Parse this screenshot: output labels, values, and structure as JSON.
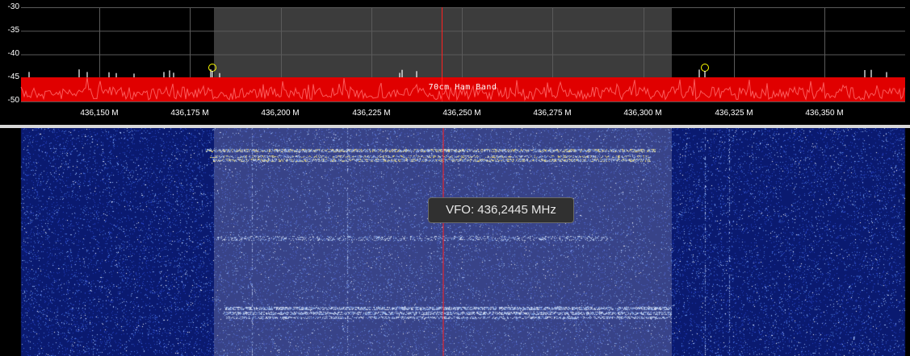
{
  "spectrum": {
    "y_axis_labels": [
      "-30",
      "-35",
      "-40",
      "-45",
      "-50"
    ],
    "y_axis_values": [
      -30,
      -35,
      -40,
      -45,
      -50
    ],
    "x_axis_labels": [
      "436,150 M",
      "436,175 M",
      "436,200 M",
      "436,225 M",
      "436,250 M",
      "436,275 M",
      "436,300 M",
      "436,325 M",
      "436,350 M"
    ],
    "x_axis_mhz": [
      436.15,
      436.175,
      436.2,
      436.225,
      436.25,
      436.275,
      436.3,
      436.325,
      436.35
    ],
    "band_label": "70cm Ham Band",
    "band_color": "#e00000",
    "passband_color": "#3c3c3c",
    "vfo_line_color": "#ff2020",
    "peak_marker_color": "#ffff00"
  },
  "vfo": {
    "tooltip": "VFO: 436,2445 MHz",
    "frequency_mhz": 436.2445
  },
  "waterfall": {
    "background_color": "#0a1a70",
    "signal_color": "#ffe45a"
  }
}
